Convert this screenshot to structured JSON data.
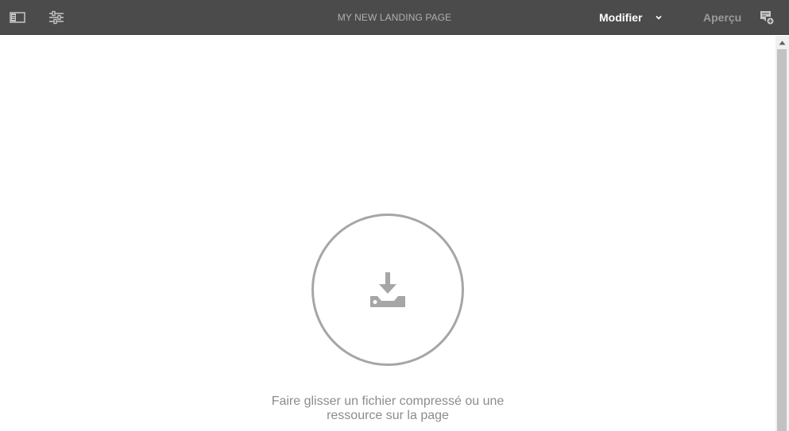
{
  "toolbar": {
    "page_title": "MY NEW LANDING PAGE",
    "mode_label": "Modifier",
    "preview_label": "Aperçu",
    "icons": {
      "side_panel": "side-panel-toggle-icon",
      "properties": "page-properties-icon",
      "mode_dropdown": "chevron-down-icon",
      "annotations": "annotation-icon"
    }
  },
  "content": {
    "dropzone_icon": "download-tray-icon",
    "drop_text_line1": "Faire glisser un fichier compressé ou une",
    "drop_text_line2": "ressource sur la page"
  },
  "colors": {
    "toolbar_bg": "#4b4b4b",
    "dropzone_gray": "#a6a6a6"
  }
}
